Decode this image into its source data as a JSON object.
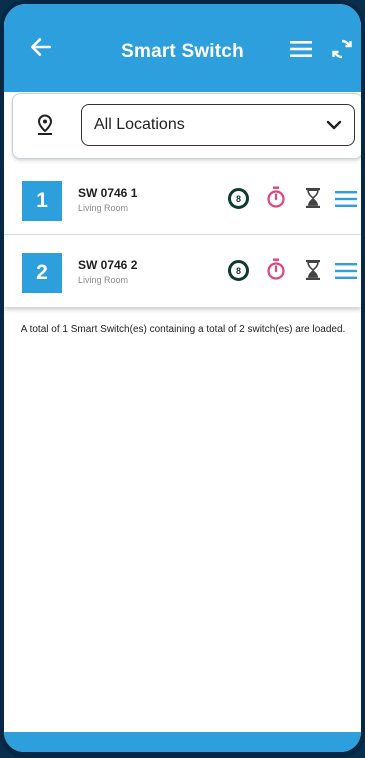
{
  "appbar": {
    "title": "Smart Switch"
  },
  "filter": {
    "location_selected": "All Locations"
  },
  "switches": [
    {
      "index": "1",
      "name": "SW 0746 1",
      "room": "Living Room",
      "counter": "8"
    },
    {
      "index": "2",
      "name": "SW 0746 2",
      "room": "Living Room",
      "counter": "8"
    }
  ],
  "summary": "A total of 1 Smart Switch(es) containing a total of 2 switch(es) are loaded.",
  "colors": {
    "accent": "#2d9fdc",
    "timer": "#e0457b",
    "counter_ring": "#0d3b2e"
  }
}
